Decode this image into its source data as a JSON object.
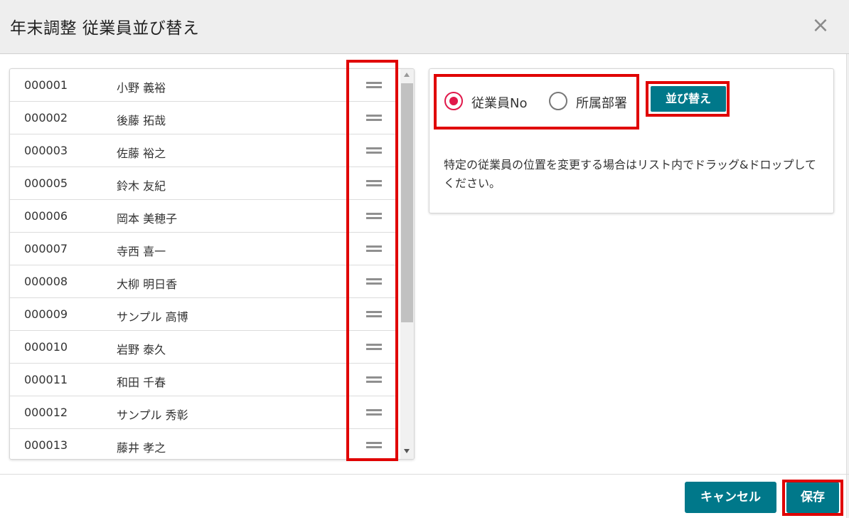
{
  "dialog": {
    "title": "年末調整 従業員並び替え",
    "close_label": "×"
  },
  "employees": [
    {
      "no": "000001",
      "name": "小野 義裕"
    },
    {
      "no": "000002",
      "name": "後藤 拓哉"
    },
    {
      "no": "000003",
      "name": "佐藤 裕之"
    },
    {
      "no": "000005",
      "name": "鈴木 友紀"
    },
    {
      "no": "000006",
      "name": "岡本 美穂子"
    },
    {
      "no": "000007",
      "name": "寺西 喜一"
    },
    {
      "no": "000008",
      "name": "大柳 明日香"
    },
    {
      "no": "000009",
      "name": "サンプル 高博"
    },
    {
      "no": "000010",
      "name": "岩野 泰久"
    },
    {
      "no": "000011",
      "name": "和田 千春"
    },
    {
      "no": "000012",
      "name": "サンプル 秀彰"
    },
    {
      "no": "000013",
      "name": "藤井 孝之"
    }
  ],
  "sort_options": {
    "options": [
      {
        "label": "従業員No",
        "checked": true
      },
      {
        "label": "所属部署",
        "checked": false
      }
    ],
    "sort_button": "並び替え",
    "hint": "特定の従業員の位置を変更する場合はリスト内でドラッグ&ドロップしてください。"
  },
  "footer": {
    "cancel_label": "キャンセル",
    "save_label": "保存"
  },
  "colors": {
    "accent": "#00788a",
    "radio_checked": "#e0184a",
    "highlight": "#e00000"
  },
  "icons": {
    "drag_handle": "drag-handle-icon",
    "close": "close-icon"
  }
}
